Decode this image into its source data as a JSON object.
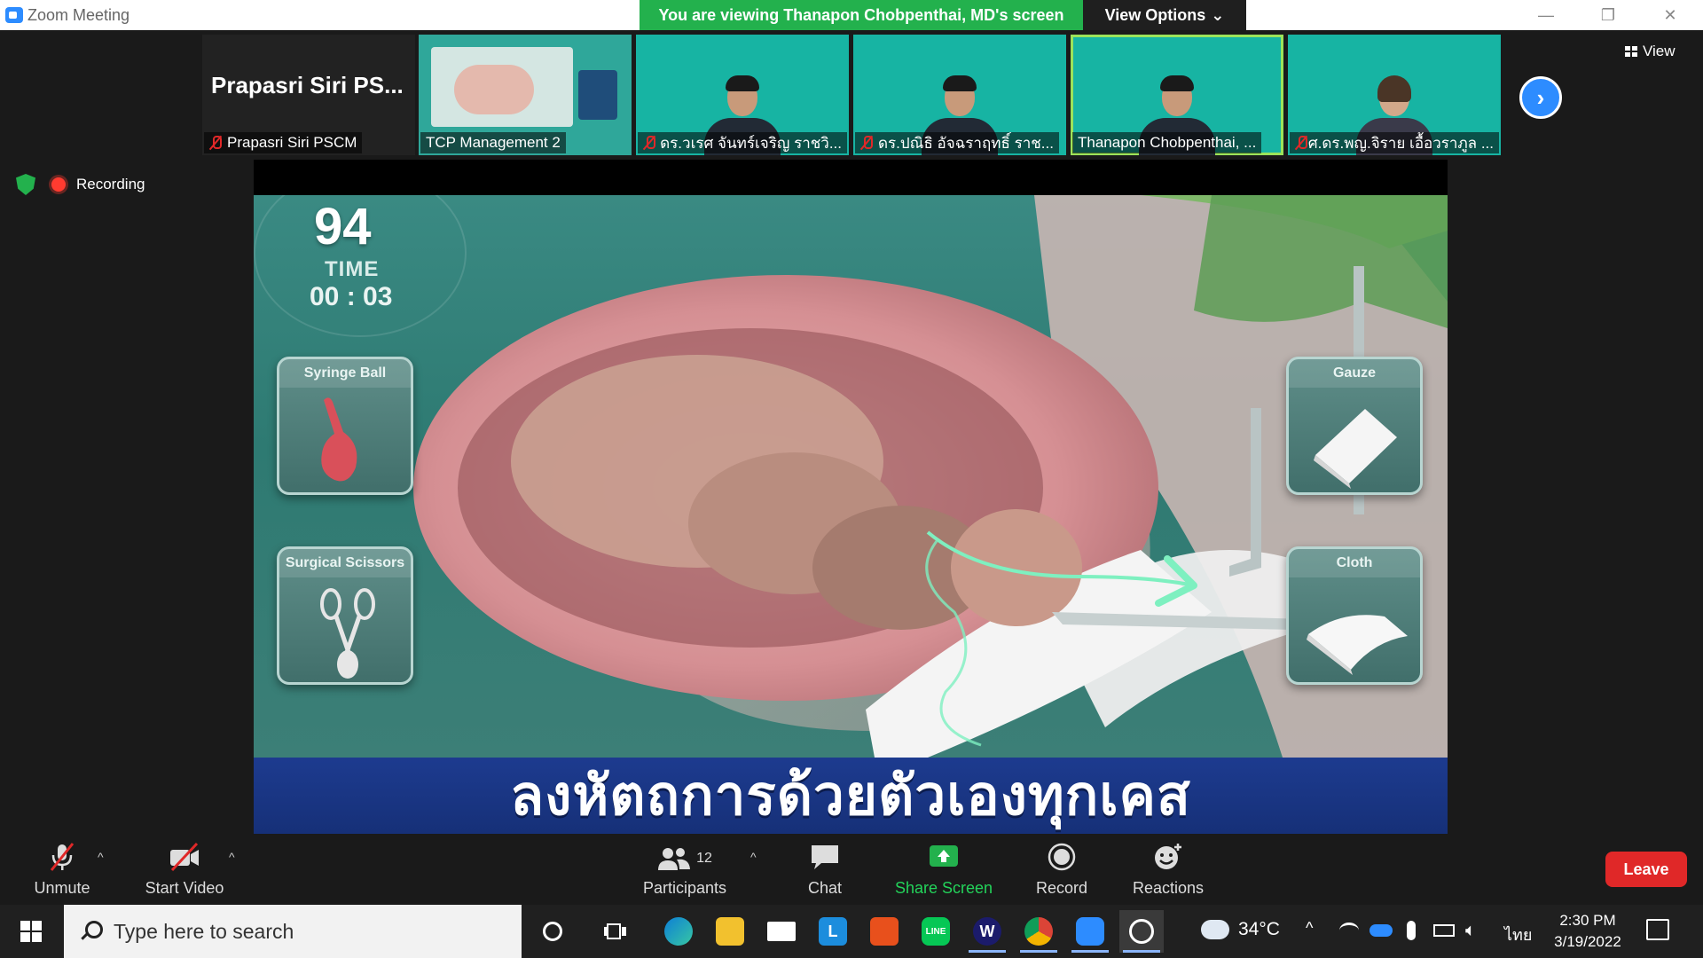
{
  "titlebar": {
    "title": "Zoom Meeting",
    "share_banner": "You are viewing Thanapon Chobpenthai, MD's screen",
    "view_options": "View Options",
    "view_options_chevron": "⌄",
    "minimize": "—",
    "restore": "❐",
    "close": "✕"
  },
  "gallery": {
    "self_name_large": "Prapasri Siri PS...",
    "self_name": "Prapasri Siri PSCM",
    "tiles": [
      {
        "name": "TCP Management 2",
        "muted": false
      },
      {
        "name": "ดร.วเรศ จันทร์เจริญ ราชวิ...",
        "muted": true
      },
      {
        "name": "ดร.ปณิธิ อัจฉราฤทธิ์ ราช...",
        "muted": true
      },
      {
        "name": "Thanapon Chobpenthai, ...",
        "muted": false,
        "active_speaker": true
      },
      {
        "name": "ศ.ดร.พญ.จิราย เอื้อวราภูล ...",
        "muted": true
      }
    ],
    "next_label": "›",
    "view_label": "View"
  },
  "status": {
    "recording_label": "Recording"
  },
  "shared_screen": {
    "score": "94",
    "time_label": "TIME",
    "time_value": "00 : 03",
    "tools": {
      "syringe_ball": "Syringe Ball",
      "surgical_scissors": "Surgical Scissors",
      "gauze": "Gauze",
      "cloth": "Cloth"
    },
    "banner": "ลงหัตถการด้วยตัวเองทุกเคส"
  },
  "toolbar": {
    "unmute": "Unmute",
    "start_video": "Start Video",
    "participants": "Participants",
    "participants_count": "12",
    "chat": "Chat",
    "share_screen": "Share Screen",
    "record": "Record",
    "reactions": "Reactions",
    "leave": "Leave",
    "caret": "^"
  },
  "taskbar": {
    "search_placeholder": "Type here to search",
    "weather": "34°C",
    "language": "ไทย",
    "time": "2:30 PM",
    "date": "3/19/2022",
    "tray_up": "^"
  },
  "colors": {
    "zoom_blue": "#2d8cff",
    "share_green": "#23b14d",
    "leave_red": "#e02828",
    "recording_red": "#ff3b30",
    "teal_bg": "#17b4a3"
  }
}
